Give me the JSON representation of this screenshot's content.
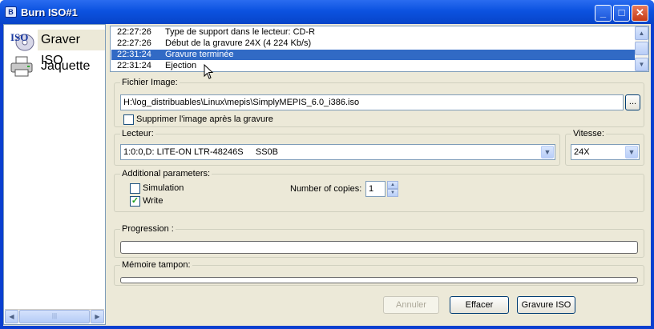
{
  "window": {
    "title": "Burn ISO#1",
    "icon_text": "B",
    "controls": {
      "minimize": "_",
      "maximize": "□",
      "close": "✕"
    }
  },
  "sidebar": {
    "items": [
      {
        "label": "Graver ISO",
        "icon": "iso-disc-icon",
        "icon_text": "ISO",
        "selected": true
      },
      {
        "label": "Jaquette",
        "icon": "printer-icon",
        "selected": false
      }
    ],
    "scroll_left": "◀",
    "scroll_right": "▶",
    "thumb_grip": "|||"
  },
  "log": {
    "rows": [
      {
        "time": "22:27:26",
        "message": "   Type de support dans le lecteur: CD-R",
        "selected": false
      },
      {
        "time": "22:27:26",
        "message": "Début de la gravure 24X (4 224 Kb/s)",
        "selected": false
      },
      {
        "time": "22:31:24",
        "message": "Gravure terminée",
        "selected": true
      },
      {
        "time": "22:31:24",
        "message": "Ejection",
        "selected": false
      }
    ],
    "scroll_up": "▲",
    "scroll_down": "▼"
  },
  "image_file": {
    "group_label": "Fichier Image:",
    "path": "H:\\log_distribuables\\Linux\\mepis\\SimplyMEPIS_6.0_i386.iso",
    "browse_label": "...",
    "delete_after_label": "Supprimer l'image après la gravure",
    "delete_after_checked": false
  },
  "drive": {
    "group_label": "Lecteur:",
    "selected": "1:0:0,D: LITE-ON LTR-48246S     SS0B",
    "dropdown_arrow": "▼"
  },
  "speed": {
    "group_label": "Vitesse:",
    "selected": "24X",
    "dropdown_arrow": "▼"
  },
  "params": {
    "group_label": "Additional parameters:",
    "simulation_label": "Simulation",
    "simulation_checked": false,
    "write_label": "Write",
    "write_checked": true,
    "check_mark": "✓",
    "copies_label": "Number of copies:",
    "copies_value": "1",
    "spin_up": "▲",
    "spin_down": "▼"
  },
  "progress": {
    "label": "Progression :",
    "value": 0
  },
  "buffer": {
    "label": "Mémoire tampon:",
    "value": 0
  },
  "buttons": {
    "cancel": "Annuler",
    "cancel_enabled": false,
    "clear": "Effacer",
    "burn": "Gravure ISO"
  }
}
